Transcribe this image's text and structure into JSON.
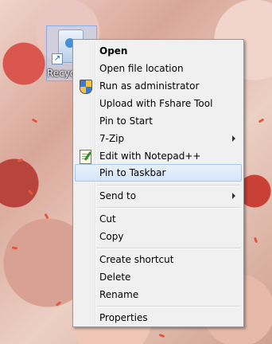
{
  "desktop": {
    "recycle_bin_label": "Recyc"
  },
  "context_menu": {
    "items": [
      {
        "label": "Open"
      },
      {
        "label": "Open file location"
      },
      {
        "label": "Run as administrator"
      },
      {
        "label": "Upload with Fshare Tool"
      },
      {
        "label": "Pin to Start"
      },
      {
        "label": "7-Zip"
      },
      {
        "label": "Edit with Notepad++"
      },
      {
        "label": "Pin to Taskbar"
      },
      {
        "label": "Send to"
      },
      {
        "label": "Cut"
      },
      {
        "label": "Copy"
      },
      {
        "label": "Create shortcut"
      },
      {
        "label": "Delete"
      },
      {
        "label": "Rename"
      },
      {
        "label": "Properties"
      }
    ]
  }
}
